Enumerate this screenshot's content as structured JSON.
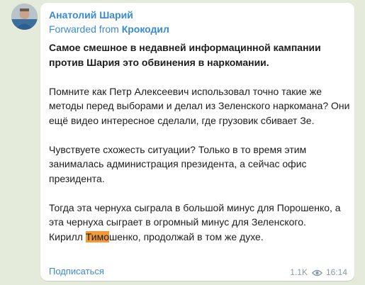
{
  "post": {
    "author": "Анатолий Шарий",
    "forwarded_prefix": "Forwarded from ",
    "forwarded_source": "Крокодил",
    "paragraph1": "Самое смешное в недавней информацинной кампании против Шария это обвинения в наркомании.",
    "paragraph2": "Помните как Петр Алексеевич использовал точно такие же методы перед выборами и делал из Зеленского наркомана? Они ещё видео интересное сделали, где грузовик сбивает Зе.",
    "paragraph3": "Чувствуете схожесть ситуации? Только в то время этим занималась администрация президента, а сейчас офис президента.",
    "paragraph4_line1": "Тогда эта чернуха сыграла в большой минус для Порошенко, а эта чернуха сыграет в огромный минус для Зеленского.",
    "paragraph4_pre": "Кирилл ",
    "paragraph4_highlight": "Тимо",
    "paragraph4_post": "шенко, продолжай в том же духе.",
    "subscribe_label": "Подписаться",
    "views": "1.1K",
    "time": "16:14",
    "eye_icon": "eye-icon"
  },
  "colors": {
    "accent": "#3a8ad3",
    "highlight": "#f09a38",
    "background": "#e4ebda"
  }
}
